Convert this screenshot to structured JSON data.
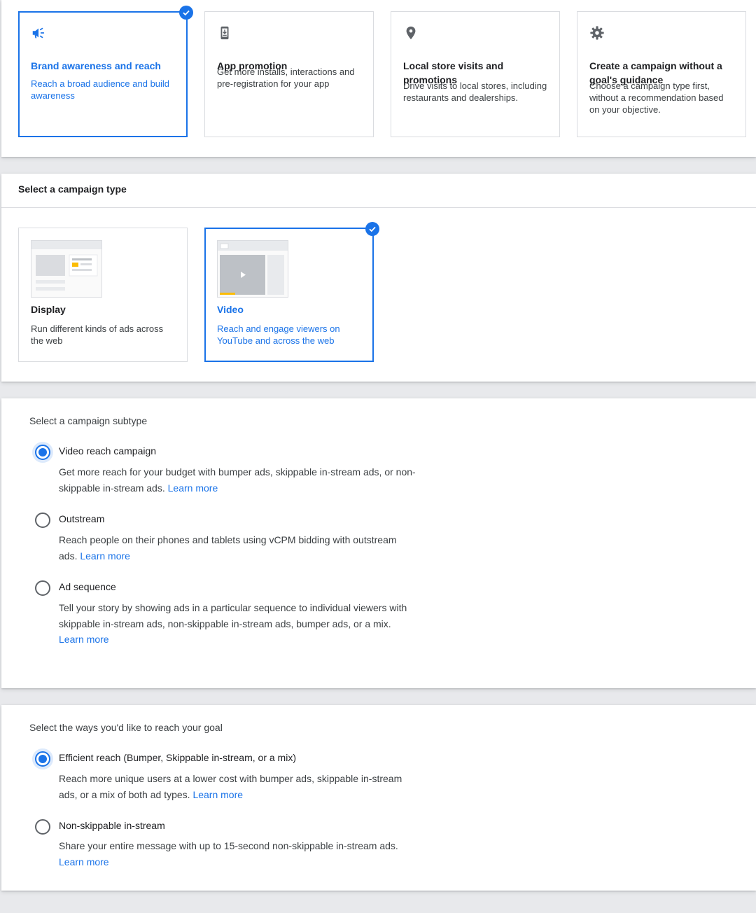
{
  "goals": [
    {
      "title": "Brand awareness and reach",
      "desc": "Reach a broad audience and build awareness",
      "icon": "megaphone-icon",
      "selected": true
    },
    {
      "title": "App promotion",
      "desc": "Get more installs, interactions and pre-registration for your app",
      "icon": "phone-download-icon",
      "selected": false
    },
    {
      "title": "Local store visits and promotions",
      "desc": "Drive visits to local stores, including restaurants and dealerships.",
      "icon": "location-pin-icon",
      "selected": false
    },
    {
      "title": "Create a campaign without a goal's guidance",
      "desc": "Choose a campaign type first, without a recommendation based on your objective.",
      "icon": "gear-icon",
      "selected": false
    }
  ],
  "campaign_type": {
    "heading": "Select a campaign type",
    "options": [
      {
        "title": "Display",
        "desc": "Run different kinds of ads across the web",
        "selected": false
      },
      {
        "title": "Video",
        "desc": "Reach and engage viewers on YouTube and across the web",
        "selected": true
      }
    ]
  },
  "subtype": {
    "heading": "Select a campaign subtype",
    "options": [
      {
        "label": "Video reach campaign",
        "desc": "Get more reach for your budget with bumper ads, skippable in-stream ads, or non-skippable in-stream ads.",
        "link": "Learn more",
        "checked": true
      },
      {
        "label": "Outstream",
        "desc": "Reach people on their phones and tablets using vCPM bidding with outstream ads.",
        "link": "Learn more",
        "checked": false
      },
      {
        "label": "Ad sequence",
        "desc": "Tell your story by showing ads in a particular sequence to individual viewers with skippable in-stream ads, non-skippable in-stream ads, bumper ads, or a mix.",
        "link": "Learn more",
        "checked": false
      }
    ]
  },
  "reach": {
    "heading": "Select the ways you'd like to reach your goal",
    "options": [
      {
        "label": "Efficient reach (Bumper, Skippable in-stream, or a mix)",
        "desc": "Reach more unique users at a lower cost with bumper ads, skippable in-stream ads, or a mix of both ad types.",
        "link": "Learn more",
        "checked": true
      },
      {
        "label": "Non-skippable in-stream",
        "desc": "Share your entire message with up to 15-second non-skippable in-stream ads.",
        "link": "Learn more",
        "checked": false
      }
    ]
  },
  "colors": {
    "accent": "#1a73e8",
    "text": "#3c4043",
    "border": "#dadce0",
    "icon": "#5f6368",
    "thumb_highlight": "#fbbc04"
  }
}
